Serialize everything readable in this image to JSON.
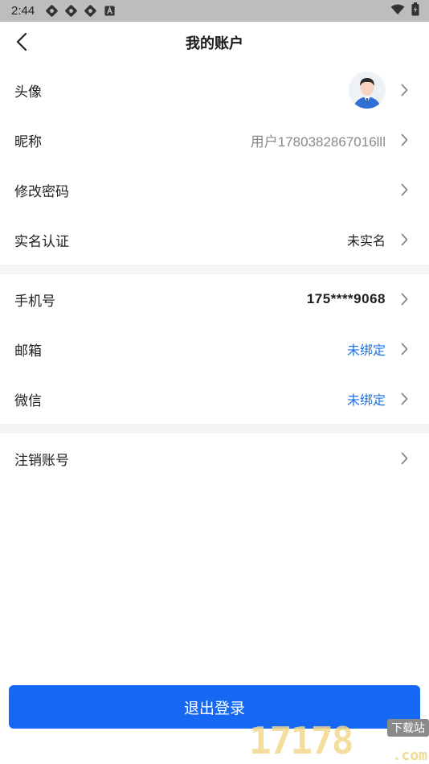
{
  "status_bar": {
    "time": "2:44",
    "left_icons": [
      "notification-icon",
      "notification-icon",
      "notification-icon",
      "accessibility-icon"
    ],
    "right_icons": [
      "wifi-icon",
      "battery-icon"
    ]
  },
  "header": {
    "title": "我的账户",
    "back_icon": "chevron-left-icon"
  },
  "sections": {
    "profile": {
      "avatar_label": "头像",
      "nickname_label": "昵称",
      "nickname_value": "用户1780382867016lll",
      "password_label": "修改密码",
      "realname_label": "实名认证",
      "realname_value": "未实名"
    },
    "bindings": {
      "phone_label": "手机号",
      "phone_value": "175****9068",
      "email_label": "邮箱",
      "email_value": "未绑定",
      "wechat_label": "微信",
      "wechat_value": "未绑定"
    },
    "account": {
      "cancel_label": "注销账号"
    }
  },
  "logout_button": "退出登录",
  "watermark": {
    "number": "17178",
    "download": "下载站",
    "domain": ".com"
  },
  "colors": {
    "accent": "#1668f2",
    "link_blue": "#1a73e8",
    "divider": "#f3f4f6",
    "status_bar": "#bdbdbd"
  }
}
